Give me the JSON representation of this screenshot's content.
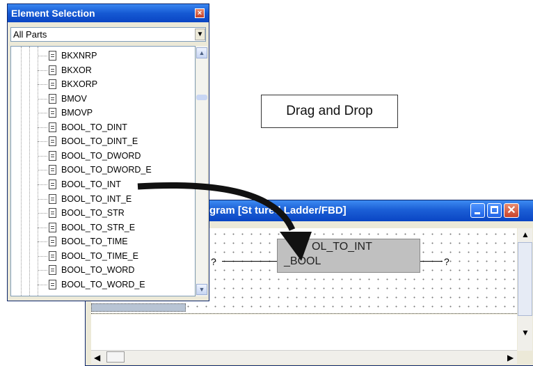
{
  "element_selection": {
    "title": "Element Selection",
    "close_glyph": "×",
    "filter": {
      "selected": "All Parts"
    },
    "items": [
      "BKXNRP",
      "BKXOR",
      "BKXORP",
      "BMOV",
      "BMOVP",
      "BOOL_TO_DINT",
      "BOOL_TO_DINT_E",
      "BOOL_TO_DWORD",
      "BOOL_TO_DWORD_E",
      "BOOL_TO_INT",
      "BOOL_TO_INT_E",
      "BOOL_TO_STR",
      "BOOL_TO_STR_E",
      "BOOL_TO_TIME",
      "BOOL_TO_TIME_E",
      "BOOL_TO_WORD",
      "BOOL_TO_WORD_E"
    ]
  },
  "drag_label": "Drag and Drop",
  "program_window": {
    "title": "gram [St  tured Ladder/FBD]",
    "function_block": {
      "name": "OL_TO_INT",
      "input": "_BOOL"
    },
    "input_value": "?",
    "output_value": "?"
  },
  "colors": {
    "titlebar": "#0a45c4",
    "block_fill": "#c0c0c0",
    "arrow": "#111111"
  }
}
